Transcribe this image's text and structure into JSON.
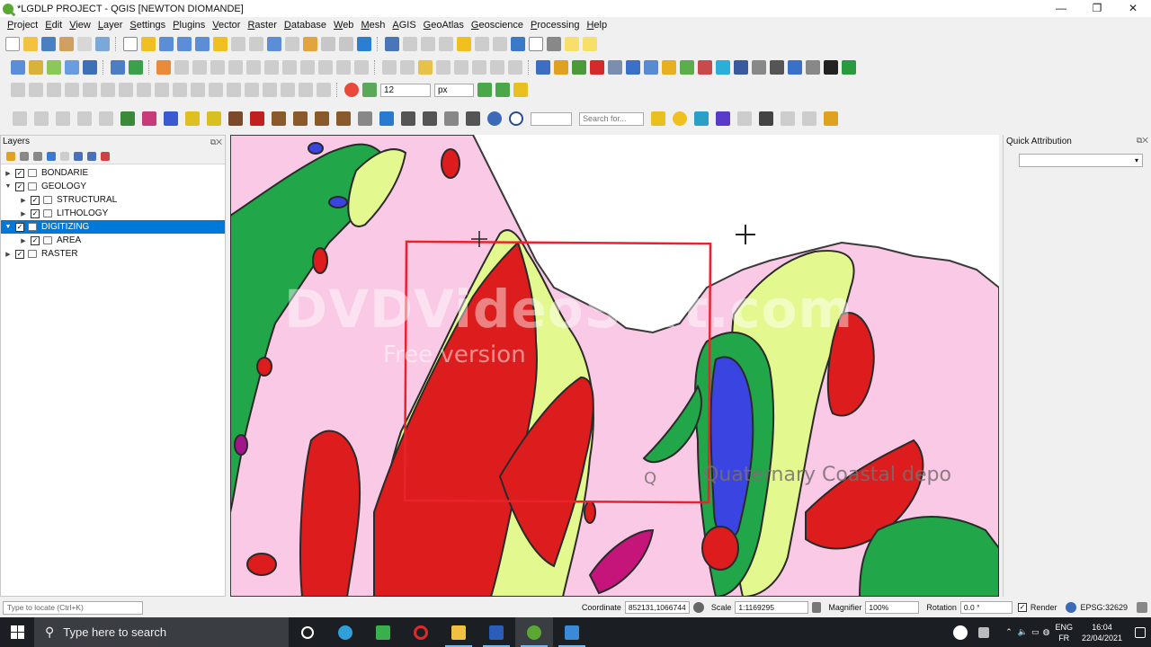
{
  "window": {
    "title": "*LGDLP PROJECT - QGIS [NEWTON DIOMANDE]",
    "minimize": "—",
    "maximize": "❐",
    "close": "✕"
  },
  "menu": [
    "Project",
    "Edit",
    "View",
    "Layer",
    "Settings",
    "Plugins",
    "Vector",
    "Raster",
    "Database",
    "Web",
    "Mesh",
    "AGIS",
    "GeoAtlas",
    "Geoscience",
    "Processing",
    "Help"
  ],
  "digitizing_toolbar": {
    "size_value": "12",
    "unit_value": "px"
  },
  "attributes_toolbar": {
    "search_placeholder": "Search for..."
  },
  "layers_panel": {
    "title": "Layers",
    "layers": [
      {
        "name": "BONDARIE",
        "level": 0,
        "expanded": false,
        "checked": true,
        "selected": false
      },
      {
        "name": "GEOLOGY",
        "level": 0,
        "expanded": true,
        "checked": true,
        "selected": false
      },
      {
        "name": "STRUCTURAL",
        "level": 1,
        "expanded": false,
        "checked": true,
        "selected": false
      },
      {
        "name": "LITHOLOGY",
        "level": 1,
        "expanded": false,
        "checked": true,
        "selected": false
      },
      {
        "name": "DIGITIZING",
        "level": 0,
        "expanded": true,
        "checked": true,
        "selected": true
      },
      {
        "name": "AREA",
        "level": 1,
        "expanded": false,
        "checked": true,
        "selected": false
      },
      {
        "name": "RASTER",
        "level": 0,
        "expanded": false,
        "checked": true,
        "selected": false
      }
    ]
  },
  "map": {
    "watermark": "DVDVideoSoft.com",
    "watermark_sub": "Free version",
    "label_q": "Q",
    "label_quaternary": "Quaternary  Coastal depo"
  },
  "quick_attribution": {
    "title": "Quick Attribution",
    "select_value": ""
  },
  "status_bar": {
    "locate_placeholder": "Type to locate (Ctrl+K)",
    "coordinate_label": "Coordinate",
    "coordinate_value": "852131,1066744",
    "scale_label": "Scale",
    "scale_value": "1:1169295",
    "magnifier_label": "Magnifier",
    "magnifier_value": "100%",
    "rotation_label": "Rotation",
    "rotation_value": "0.0 °",
    "render_label": "Render",
    "crs": "EPSG:32629"
  },
  "taskbar": {
    "search_placeholder": "Type here to search",
    "lang_top": "ENG",
    "lang_bottom": "FR",
    "time": "16:04",
    "date": "22/04/2021"
  },
  "colors": {
    "selection": "#0078d7",
    "geo_pink": "#f9c9e5",
    "geo_red": "#dd1d1d",
    "geo_lime": "#e3f98f",
    "geo_green": "#22a64a",
    "geo_blue": "#3a44e0",
    "frame_red": "#e8232a"
  }
}
